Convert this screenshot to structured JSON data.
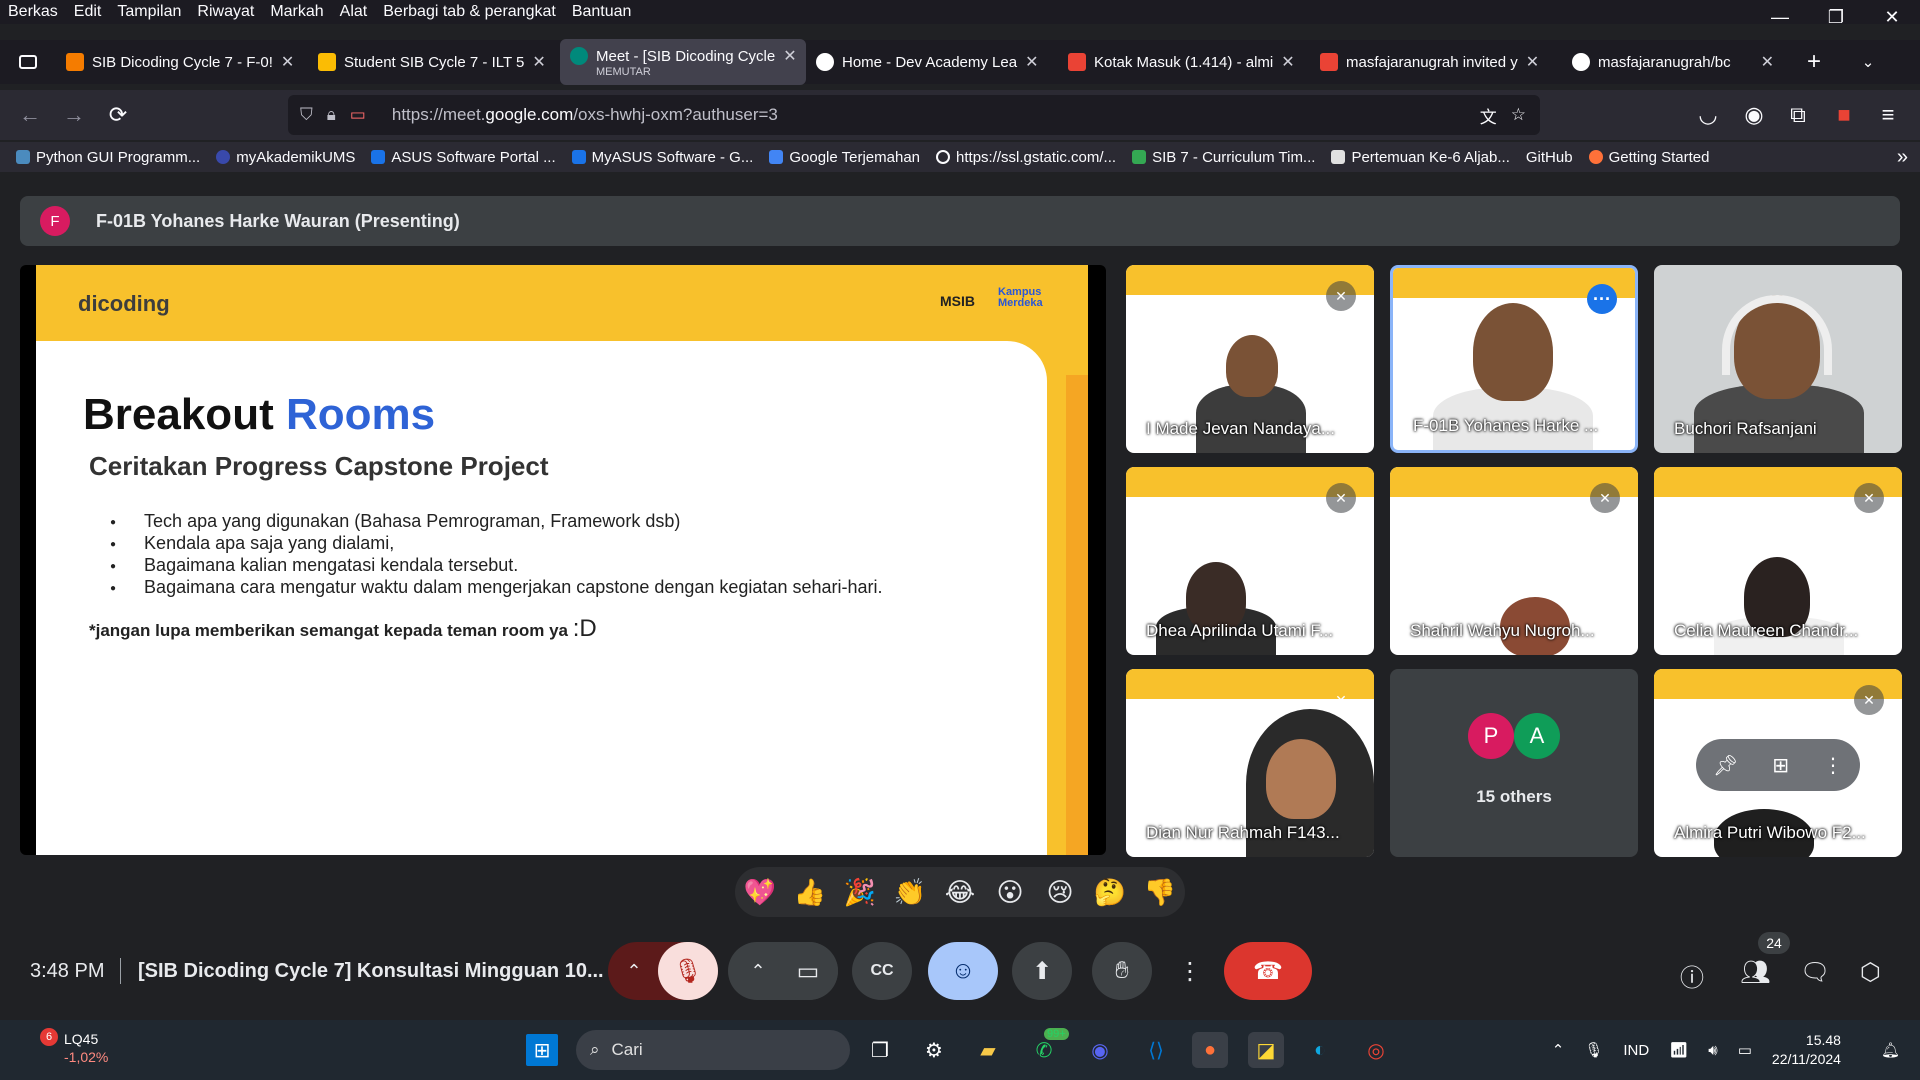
{
  "menubar": {
    "items": [
      "Berkas",
      "Edit",
      "Tampilan",
      "Riwayat",
      "Markah",
      "Alat",
      "Berbagi tab & perangkat",
      "Bantuan"
    ]
  },
  "window": {
    "minimize": "—",
    "restore": "❐",
    "close": "✕"
  },
  "tabs": [
    {
      "title": "SIB Dicoding Cycle 7 - F-0!",
      "color": "#f57c00"
    },
    {
      "title": "Student SIB Cycle 7 - ILT 5",
      "color": "#fbbc04"
    },
    {
      "title": "Meet - [SIB Dicoding Cycle",
      "sub": "MEMUTAR",
      "color": "#00897b"
    },
    {
      "title": "Home - Dev Academy Lea",
      "color": "#ffffff"
    },
    {
      "title": "Kotak Masuk (1.414) - almi",
      "color": "#ea4335"
    },
    {
      "title": "masfajaranugrah invited y",
      "color": "#ea4335"
    },
    {
      "title": "masfajaranugrah/bc",
      "color": "#ffffff"
    }
  ],
  "url": {
    "prefix": "https://meet.",
    "domain": "google.com",
    "path": "/oxs-hwhj-oxm?authuser=3"
  },
  "bookmarks": [
    "Python GUI Programm...",
    "myAkademikUMS",
    "ASUS Software Portal ...",
    "MyASUS Software - G...",
    "Google Terjemahan",
    "https://ssl.gstatic.com/...",
    "SIB 7 - Curriculum Tim...",
    "Pertemuan Ke-6 Aljab...",
    "GitHub",
    "Getting Started"
  ],
  "presenter": {
    "initial": "F",
    "label": "F-01B Yohanes Harke Wauran (Presenting)"
  },
  "slide": {
    "logo": "dicoding",
    "msib": "MSIB",
    "km": "Kampus Merdeka",
    "title_a": "Breakout ",
    "title_b": "Rooms",
    "subtitle": "Ceritakan Progress Capstone Project",
    "bullets": [
      "Tech apa yang digunakan (Bahasa Pemrograman, Framework dsb)",
      "Kendala apa saja yang dialami,",
      "Bagaimana kalian mengatasi kendala tersebut.",
      "Bagaimana cara mengatur waktu dalam mengerjakan capstone dengan kegiatan sehari-hari."
    ],
    "note": "*jangan lupa memberikan semangat kepada teman room ya ",
    "note_face": ":D"
  },
  "participants": [
    {
      "name": "I Made Jevan Nandaya..."
    },
    {
      "name": "F-01B Yohanes Harke ..."
    },
    {
      "name": "Buchori Rafsanjani"
    },
    {
      "name": "Dhea Aprilinda Utami F..."
    },
    {
      "name": "Shahril Wahyu Nugroh..."
    },
    {
      "name": "Celia Maureen Chandr..."
    },
    {
      "name": "Dian Nur Rahmah F143..."
    },
    {
      "name": "Almira Putri Wibowo F2..."
    }
  ],
  "others": {
    "a": "P",
    "b": "A",
    "label": "15 others"
  },
  "reactions": [
    "💖",
    "👍",
    "🎉",
    "👏",
    "😂",
    "😮",
    "😢",
    "🤔",
    "👎"
  ],
  "meeting": {
    "time": "3:48 PM",
    "title": "[SIB Dicoding Cycle 7] Konsultasi Mingguan 10...",
    "people_count": "24"
  },
  "taskbar": {
    "stock": "LQ45",
    "stock_change": "-1,02%",
    "stock_badge": "6",
    "search": "Cari",
    "whatsapp_badge": "99+",
    "lang": "IND",
    "time": "15.48",
    "date": "22/11/2024"
  }
}
